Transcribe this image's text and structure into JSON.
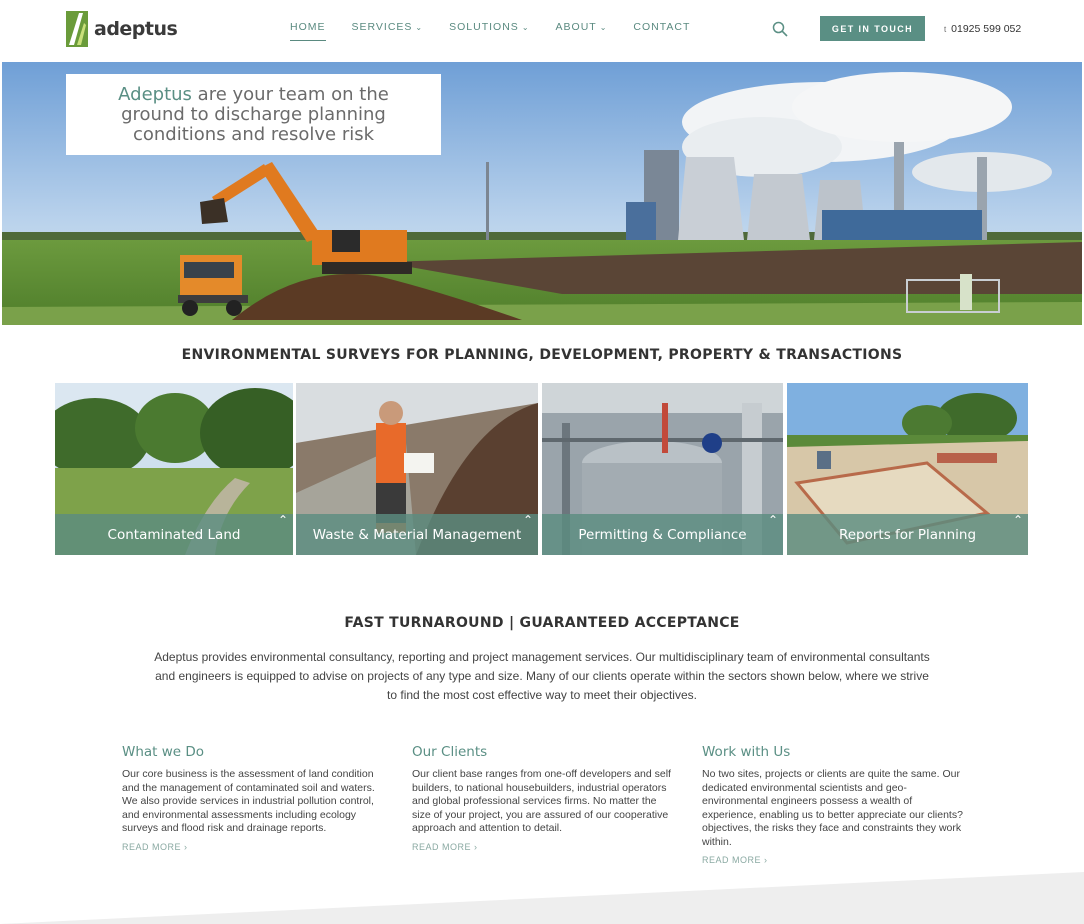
{
  "brand": {
    "name": "adeptus",
    "accent": "#5a8f84"
  },
  "nav": {
    "items": [
      {
        "label": "HOME",
        "dropdown": false,
        "active": true
      },
      {
        "label": "SERVICES",
        "dropdown": true
      },
      {
        "label": "SOLUTIONS",
        "dropdown": true
      },
      {
        "label": "ABOUT",
        "dropdown": true
      },
      {
        "label": "CONTACT",
        "dropdown": false
      }
    ],
    "search_icon": "search-icon",
    "cta_label": "GET IN TOUCH",
    "phone_prefix": "t",
    "phone": "01925 599 052"
  },
  "hero": {
    "brand_word": "Adeptus",
    "tagline": " are your team on the ground to discharge planning conditions and resolve risk"
  },
  "section1": {
    "title": "ENVIRONMENTAL SURVEYS FOR PLANNING, DEVELOPMENT, PROPERTY & TRANSACTIONS"
  },
  "tiles": [
    {
      "label": "Contaminated Land"
    },
    {
      "label": "Waste & Material Management"
    },
    {
      "label": "Permitting & Compliance"
    },
    {
      "label": "Reports for Planning"
    }
  ],
  "section2": {
    "title": "FAST TURNAROUND | GUARANTEED ACCEPTANCE",
    "intro": "Adeptus provides environmental consultancy, reporting and project management services. Our multidisciplinary team of environmental consultants and engineers is equipped to advise on projects of any type and size. Many of our clients operate within the sectors shown below, where we strive to find the most cost effective way to meet their objectives."
  },
  "columns": [
    {
      "title": "What we Do",
      "text": "Our core business is the assessment of land condition and the management of contaminated soil and waters. We also provide services in industrial pollution control, and environmental assessments including ecology surveys and flood risk and drainage reports.",
      "more": "READ MORE ›"
    },
    {
      "title": "Our Clients",
      "text": "Our client base ranges from one-off developers and self builders, to national housebuilders, industrial operators and global professional services firms. No matter the size of your project, you are assured of our cooperative approach and attention to detail.",
      "more": "READ MORE ›"
    },
    {
      "title": "Work with Us",
      "text": "No two sites, projects or clients are quite the same. Our dedicated environmental scientists and geo-environmental engineers possess a wealth of experience, enabling us to better appreciate our clients? objectives, the risks they face and constraints they work within.",
      "more": "READ MORE ›"
    }
  ]
}
